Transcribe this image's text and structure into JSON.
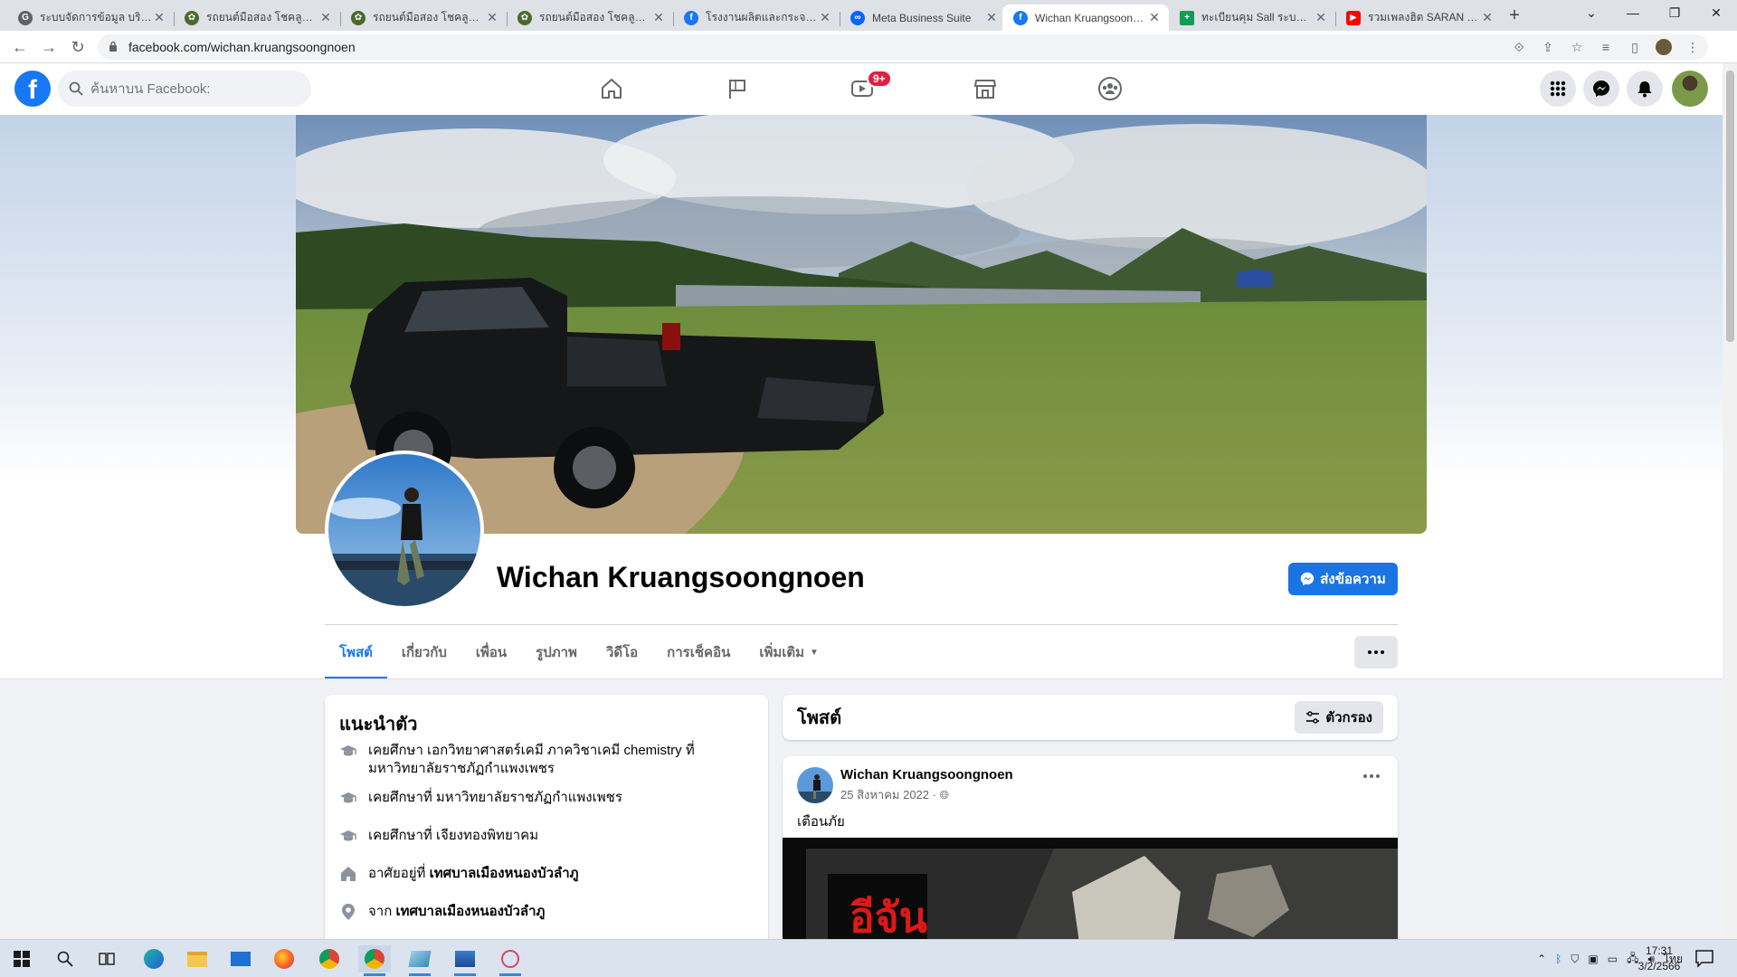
{
  "browser": {
    "tabs": [
      {
        "title": "ระบบจัดการข้อมูล บริษัท ไ",
        "fav_color": "#5f6368",
        "fav_glyph": "G"
      },
      {
        "title": "รถยนต์มือสอง โชคลูกนโยา",
        "fav_color": "#4a6a2a",
        "fav_glyph": "✿"
      },
      {
        "title": "รถยนต์มือสอง โชคลูกนโยา",
        "fav_color": "#4a6a2a",
        "fav_glyph": "✿"
      },
      {
        "title": "รถยนต์มือสอง โชคลูกนโยา",
        "fav_color": "#4a6a2a",
        "fav_glyph": "✿"
      },
      {
        "title": "โรงงานผลิตและกระจายรถ",
        "fav_color": "#1877f2",
        "fav_glyph": "f"
      },
      {
        "title": "Meta Business Suite",
        "fav_color": "#0866ff",
        "fav_glyph": "∞"
      },
      {
        "title": "Wichan Kruangsoongnoen",
        "fav_color": "#1877f2",
        "fav_glyph": "f"
      },
      {
        "title": "ทะเบียนคุม Sall ระบบออนไ",
        "fav_color": "#0f9d58",
        "fav_glyph": "+"
      },
      {
        "title": "รวมเพลงฮิต SARAN เพล",
        "fav_color": "#ff0000",
        "fav_glyph": "▶"
      }
    ],
    "new_tab": "+",
    "url": "facebook.com/wichan.kruangsoongnoen"
  },
  "fbnav": {
    "logo": "f",
    "search_placeholder": "ค้นหาบน Facebook:",
    "video_badge": "9+"
  },
  "profile": {
    "name": "Wichan Kruangsoongnoen",
    "message_button": "ส่งข้อความ",
    "tabs": [
      {
        "label": "โพสต์"
      },
      {
        "label": "เกี่ยวกับ"
      },
      {
        "label": "เพื่อน"
      },
      {
        "label": "รูปภาพ"
      },
      {
        "label": "วิดีโอ"
      },
      {
        "label": "การเช็คอิน"
      },
      {
        "label": "เพิ่มเติม"
      }
    ]
  },
  "intro": {
    "title": "แนะนำตัว",
    "items": [
      {
        "icon": "graduation-cap-icon",
        "text": "เคยศึกษา เอกวิทยาศาสตร์เคมี ภาควิชาเคมี chemistry ที่ มหาวิทยาลัยราชภัฏกำแพงเพชร",
        "bold": ""
      },
      {
        "icon": "graduation-cap-icon",
        "text": "เคยศึกษาที่ มหาวิทยาลัยราชภัฏกำแพงเพชร",
        "bold": ""
      },
      {
        "icon": "graduation-cap-icon",
        "text": "เคยศึกษาที่ เจียงทองพิทยาคม",
        "bold": ""
      },
      {
        "icon": "home-icon",
        "text": "อาศัยอยู่ที่ ",
        "bold": "เทศบาลเมืองหนองบัวลำภู"
      },
      {
        "icon": "location-pin-icon",
        "text": "จาก ",
        "bold": "เทศบาลเมืองหนองบัวลำภู"
      }
    ]
  },
  "posts": {
    "title": "โพสต์",
    "filter_button": "ตัวกรอง",
    "first": {
      "author": "Wichan Kruangsoongnoen",
      "date": "25 สิงหาคม 2022 · ",
      "text": "เตือนภัย",
      "image_text": "อีจัน"
    }
  },
  "taskbar": {
    "lang": "ไทย",
    "time": "17:31",
    "date": "3/2/2566"
  },
  "colors": {
    "fb_blue": "#1877f2",
    "badge_red": "#e41e3f"
  }
}
